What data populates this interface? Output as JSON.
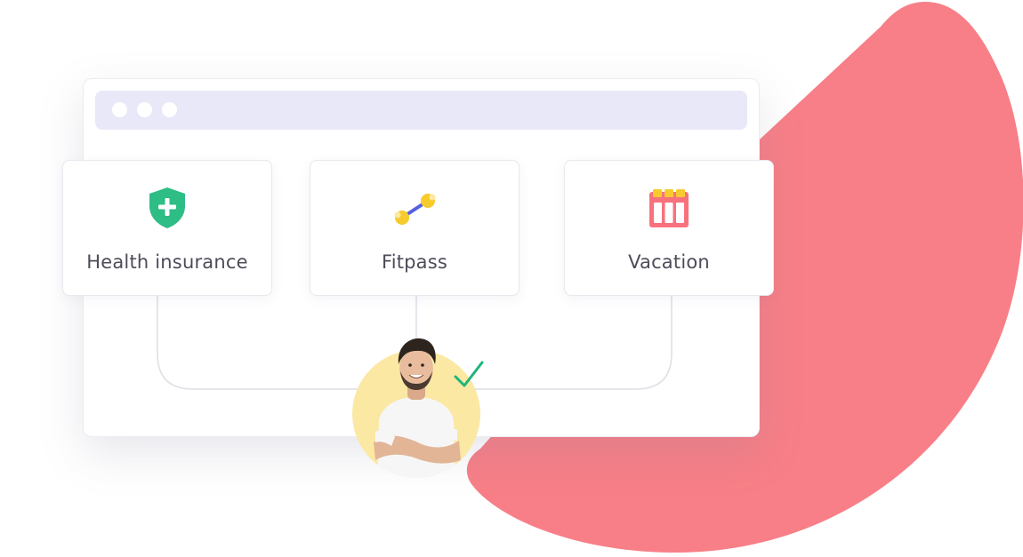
{
  "cards": [
    {
      "label": "Health insurance",
      "icon": "shield-plus-icon",
      "color": "#2ebd85"
    },
    {
      "label": "Fitpass",
      "icon": "dumbbell-icon",
      "color": "#f7cb2e"
    },
    {
      "label": "Vacation",
      "icon": "calendar-icon",
      "color": "#f8727d"
    }
  ],
  "window": {
    "titlebar_color": "#e9e8f8",
    "dots": 3
  },
  "accent_blob_color": "#f87f87",
  "avatar": {
    "icon": "person-avatar",
    "ring_color": "#fbe8a3",
    "status": "approved-check-icon",
    "status_color": "#1fb57a"
  }
}
